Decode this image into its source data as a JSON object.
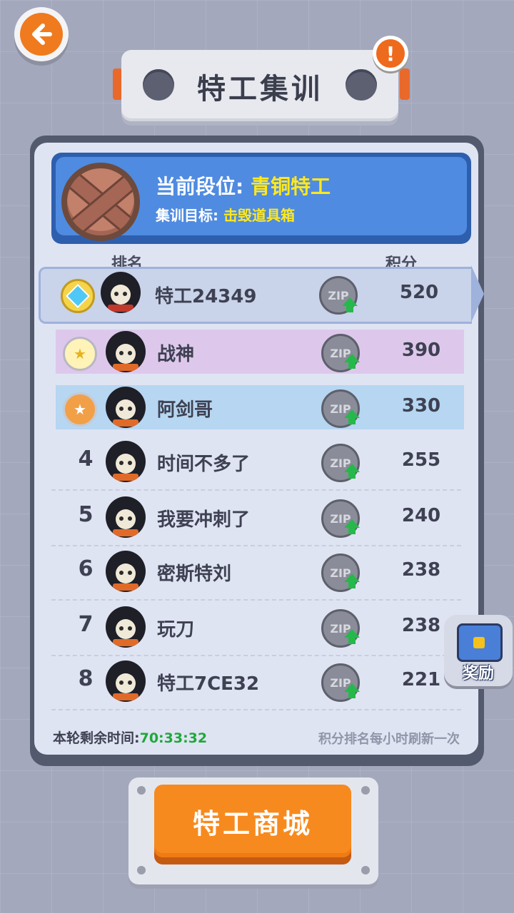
{
  "header": {
    "title": "特工集训",
    "back_icon": "back-arrow-icon",
    "alert_symbol": "!"
  },
  "rank_panel": {
    "rank_label": "当前段位: ",
    "rank_value": "青铜特工",
    "goal_label": "集训目标: ",
    "goal_value": "击毁道具箱"
  },
  "leaderboard": {
    "col_rank": "排名",
    "col_score": "积分",
    "coin_label": "ZIP",
    "rows": [
      {
        "rank": "1",
        "name": "特工24349",
        "score": "520"
      },
      {
        "rank": "2",
        "name": "战神",
        "score": "390"
      },
      {
        "rank": "3",
        "name": "阿剑哥",
        "score": "330"
      },
      {
        "rank": "4",
        "name": "时间不多了",
        "score": "255"
      },
      {
        "rank": "5",
        "name": "我要冲刺了",
        "score": "240"
      },
      {
        "rank": "6",
        "name": "密斯特刘",
        "score": "238"
      },
      {
        "rank": "7",
        "name": "玩刀",
        "score": "238"
      },
      {
        "rank": "8",
        "name": "特工7CE32",
        "score": "221"
      }
    ]
  },
  "footer": {
    "time_label": "本轮剩余时间:",
    "time_value": "70:33:32",
    "refresh_note": "积分排名每小时刷新一次"
  },
  "reward": {
    "label": "奖励"
  },
  "shop": {
    "label": "特工商城"
  }
}
